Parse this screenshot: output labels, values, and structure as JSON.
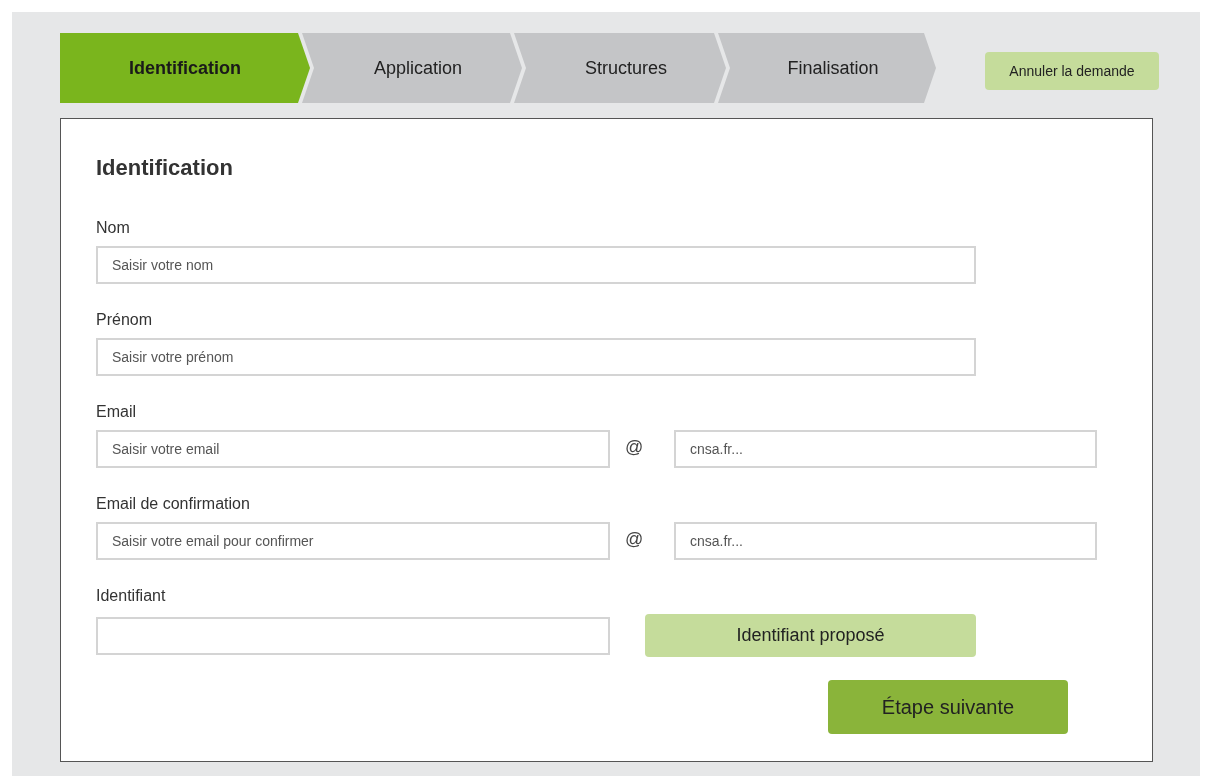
{
  "steps": [
    {
      "label": "Identification",
      "selected": true
    },
    {
      "label": "Application",
      "selected": false
    },
    {
      "label": "Structures",
      "selected": false
    },
    {
      "label": "Finalisation",
      "selected": false
    }
  ],
  "cancel_button": "Annuler la demande",
  "form": {
    "title": "Identification",
    "fields": [
      {
        "kind": "text",
        "label": "Nom",
        "placeholder": "Saisir votre nom"
      },
      {
        "kind": "text",
        "label": "Prénom",
        "placeholder": "Saisir votre prénom"
      },
      {
        "kind": "email",
        "label": "Email",
        "placeholder": "Saisir votre email",
        "at": "@",
        "domain_placeholder": "cnsa.fr..."
      },
      {
        "kind": "email",
        "label": "Email de confirmation",
        "placeholder": "Saisir votre email pour confirmer",
        "at": "@",
        "domain_placeholder": "cnsa.fr..."
      },
      {
        "kind": "identifier",
        "label": "Identifiant",
        "button": "Identifiant proposé"
      }
    ]
  },
  "next_button": "Étape suivante"
}
